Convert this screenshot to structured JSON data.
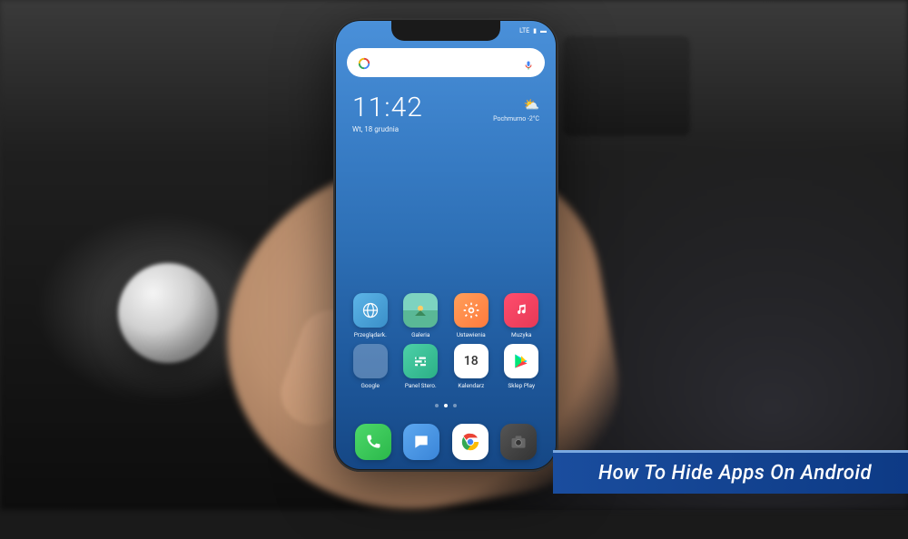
{
  "caption": "How To Hide Apps On Android",
  "status": {
    "network": "LTE",
    "signal_icon": "signal-icon",
    "battery_icon": "battery-icon"
  },
  "clock": {
    "time": "11:42",
    "date": "Wt, 18 grudnia"
  },
  "weather": {
    "location": "Pochmurno",
    "temp": "-2°C",
    "icon_glyph": "⛅"
  },
  "calendar": {
    "day": "18"
  },
  "apps": {
    "row1": [
      {
        "name": "browser",
        "label": "Przeglądark."
      },
      {
        "name": "gallery",
        "label": "Galeria"
      },
      {
        "name": "settings",
        "label": "Ustawienia"
      },
      {
        "name": "music",
        "label": "Muzyka"
      }
    ],
    "row2": [
      {
        "name": "google-folder",
        "label": "Google"
      },
      {
        "name": "panel",
        "label": "Panel Stero."
      },
      {
        "name": "calendar",
        "label": "Kalendarz"
      },
      {
        "name": "play",
        "label": "Sklep Play"
      }
    ]
  },
  "dock": [
    {
      "name": "phone"
    },
    {
      "name": "messages"
    },
    {
      "name": "chrome"
    },
    {
      "name": "camera"
    }
  ]
}
